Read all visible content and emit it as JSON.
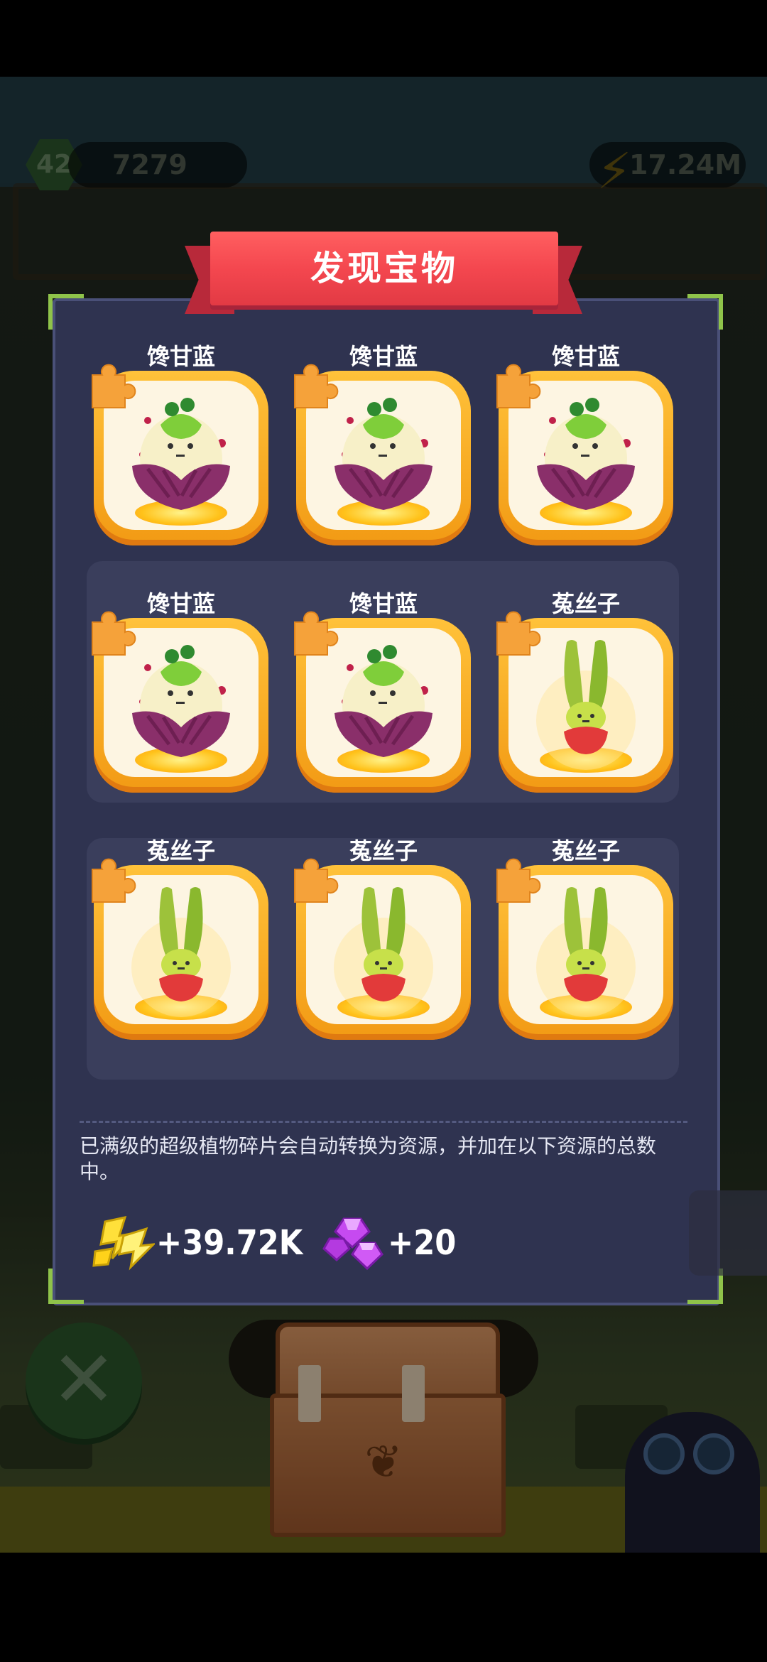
{
  "hud": {
    "level": "42",
    "coins": "7279",
    "energy": "17.24M"
  },
  "dialog": {
    "title": "发现宝物",
    "items": [
      {
        "name": "馋甘蓝",
        "plant": "cabbage"
      },
      {
        "name": "馋甘蓝",
        "plant": "cabbage"
      },
      {
        "name": "馋甘蓝",
        "plant": "cabbage"
      },
      {
        "name": "馋甘蓝",
        "plant": "cabbage"
      },
      {
        "name": "馋甘蓝",
        "plant": "cabbage"
      },
      {
        "name": "菟丝子",
        "plant": "dodder"
      },
      {
        "name": "菟丝子",
        "plant": "dodder"
      },
      {
        "name": "菟丝子",
        "plant": "dodder"
      },
      {
        "name": "菟丝子",
        "plant": "dodder"
      }
    ],
    "note": "已满级的超级植物碎片会自动转换为资源，并加在以下资源的总数中。",
    "rewards": [
      {
        "icon": "lightning-energy-icon",
        "value": "+39.72K"
      },
      {
        "icon": "purple-gem-icon",
        "value": "+20"
      }
    ]
  },
  "colors": {
    "ribbon": "#f4474f",
    "panel": "#2f3350",
    "card_border": "#f29a14",
    "corner_accent": "#8fc34a"
  }
}
